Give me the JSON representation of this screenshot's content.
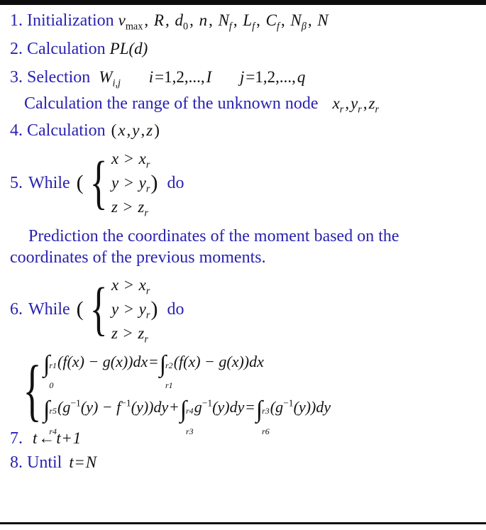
{
  "document": {
    "type": "algorithm-pseudocode-block",
    "text_color": "#2a22b0",
    "math_color": "#111111",
    "background": "#ffffff",
    "rule_color": "#0d0d0d"
  },
  "steps": {
    "s1": {
      "number": "1.",
      "keyword": "Initialization",
      "math": "v_max , R , d_0 , n , N_f , L_f , C_f , N_β , N",
      "vars": {
        "v": "v",
        "vsub": "max",
        "R": "R",
        "d": "d",
        "dsub": "0",
        "n": "n",
        "N1": "N",
        "N1sub": "f",
        "L": "L",
        "Lsub": "f",
        "C": "C",
        "Csub": "f",
        "N2": "N",
        "N2sub": "β",
        "N3": "N",
        "comma": ","
      }
    },
    "s2": {
      "number": "2.",
      "keyword": "Calculation",
      "math_pl": "PL",
      "math_arg": "(d)"
    },
    "s3": {
      "number": "3.",
      "keyword": "Selection",
      "w": "W",
      "wsub": "i,j",
      "i_range": "i = 1,2,...,I",
      "j_range": "j = 1,2,...,q",
      "i_var": "i",
      "i_eq": "=1,2,...,",
      "i_end": "I",
      "j_var": "j",
      "j_eq": "=1,2,...,",
      "j_end": "q"
    },
    "s3b": {
      "text": "Calculation the range of the unknown node",
      "x": "x",
      "xsub": "r",
      "y": "y",
      "ysub": "r",
      "z": "z",
      "zsub": "r",
      "comma": ","
    },
    "s4": {
      "number": "4.",
      "keyword": "Calculation",
      "math": "(x, y, z)",
      "open": "(",
      "x": "x",
      "y": "y",
      "z": "z",
      "comma": ",",
      "close": ")"
    },
    "s5": {
      "number": "5.",
      "keyword": "While",
      "open_paren": "(",
      "close_paren": ")",
      "do": "do",
      "conditions": [
        {
          "lhs": "x",
          "op": ">",
          "rhs": "x",
          "sub": "r"
        },
        {
          "lhs": "y",
          "op": ">",
          "rhs": "y",
          "sub": "r"
        },
        {
          "lhs": "z",
          "op": ">",
          "rhs": "z",
          "sub": "r"
        }
      ]
    },
    "prediction": {
      "line1": "Prediction the coordinates of the moment based on",
      "line2": "the coordinates of the previous moments.",
      "full": "Prediction the coordinates of the moment based on the coordinates of the previous moments."
    },
    "s6": {
      "number": "6.",
      "keyword": "While",
      "open_paren": "(",
      "close_paren": ")",
      "do": "do",
      "conditions": [
        {
          "lhs": "x",
          "op": ">",
          "rhs": "x",
          "sub": "r"
        },
        {
          "lhs": "y",
          "op": ">",
          "rhs": "y",
          "sub": "r"
        },
        {
          "lhs": "z",
          "op": ">",
          "rhs": "z",
          "sub": "r"
        }
      ]
    },
    "integrals": {
      "eq1": {
        "latex": "\\int_{0}^{r1}(f(x)-g(x))dx = \\int_{r1}^{r2}(f(x)-g(x))dx",
        "int1_lo": "0",
        "int1_hi": "r1",
        "body1": "(f(x) − g(x))dx",
        "equals": "=",
        "int2_lo": "r1",
        "int2_hi": "r2",
        "body2": "(f(x) − g(x))dx"
      },
      "eq2": {
        "latex": "\\int_{r4}^{r5}(g^{-1}(y)-f^{-1}(y))dy + \\int_{r3}^{r4} g^{-1}(y)dy = \\int_{r6}^{r3}(g^{-1}(y))dy",
        "int1_lo": "r4",
        "int1_hi": "r5",
        "body1_a": "(g",
        "body1_sup": "−1",
        "body1_b": "(y) − f",
        "body1_sup2": "−1",
        "body1_c": "(y))dy",
        "plus": "+",
        "int2_lo": "r3",
        "int2_hi": "r4",
        "body2_a": "g",
        "body2_sup": "−1",
        "body2_b": "(y)dy",
        "equals": "=",
        "int3_lo": "r6",
        "int3_hi": "r3",
        "body3_a": "(g",
        "body3_sup": "−1",
        "body3_b": "(y))dy"
      }
    },
    "s7": {
      "number": "7.",
      "t": "t",
      "arrow": "←",
      "expr": "t + 1",
      "t2": "t",
      "plus": "+",
      "one": "1"
    },
    "s8": {
      "number": "8.",
      "keyword": "Until",
      "t": "t",
      "equals": "=",
      "n": "N"
    }
  }
}
